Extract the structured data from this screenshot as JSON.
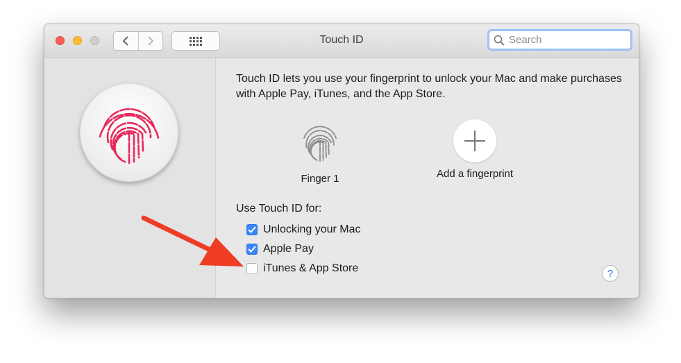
{
  "window": {
    "title": "Touch ID",
    "search": {
      "placeholder": "Search",
      "value": ""
    }
  },
  "main": {
    "description": "Touch ID lets you use your fingerprint to unlock your Mac and make purchases with Apple Pay, iTunes, and the App Store.",
    "fingerprints": [
      {
        "label": "Finger 1",
        "icon": "fingerprint-icon"
      },
      {
        "label": "Add a fingerprint",
        "icon": "plus-icon"
      }
    ],
    "use_for_label": "Use Touch ID for:",
    "options": [
      {
        "label": "Unlocking your Mac",
        "checked": true
      },
      {
        "label": "Apple Pay",
        "checked": true
      },
      {
        "label": "iTunes & App Store",
        "checked": false
      }
    ],
    "help_label": "?"
  },
  "colors": {
    "fingerprint_accent": "#e8285a",
    "checkbox_checked": "#3b86f7",
    "annotation_arrow": "#ee3d24",
    "search_focus_ring": "#9cc3f3"
  }
}
